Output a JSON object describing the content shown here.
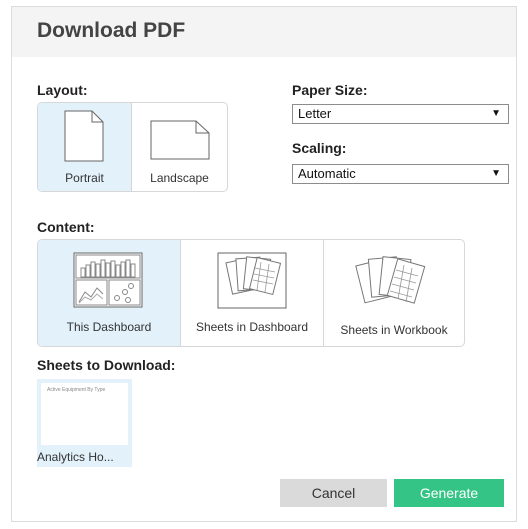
{
  "dialog": {
    "title": "Download PDF"
  },
  "layout": {
    "label": "Layout:",
    "options": [
      {
        "label": "Portrait",
        "selected": true
      },
      {
        "label": "Landscape",
        "selected": false
      }
    ]
  },
  "paper_size": {
    "label": "Paper Size:",
    "value": "Letter"
  },
  "scaling": {
    "label": "Scaling:",
    "value": "Automatic"
  },
  "content": {
    "label": "Content:",
    "options": [
      {
        "label": "This Dashboard",
        "selected": true
      },
      {
        "label": "Sheets in Dashboard",
        "selected": false
      },
      {
        "label": "Sheets in Workbook",
        "selected": false
      }
    ]
  },
  "sheets": {
    "label": "Sheets to Download:",
    "items": [
      {
        "name": "Analytics Ho...",
        "preview_title": "Active Equipment By Type",
        "selected": true
      }
    ]
  },
  "buttons": {
    "cancel": "Cancel",
    "generate": "Generate"
  },
  "colors": {
    "selected_bg": "#e2f1fa",
    "generate_bg": "#34c486",
    "cancel_bg": "#dadada"
  }
}
